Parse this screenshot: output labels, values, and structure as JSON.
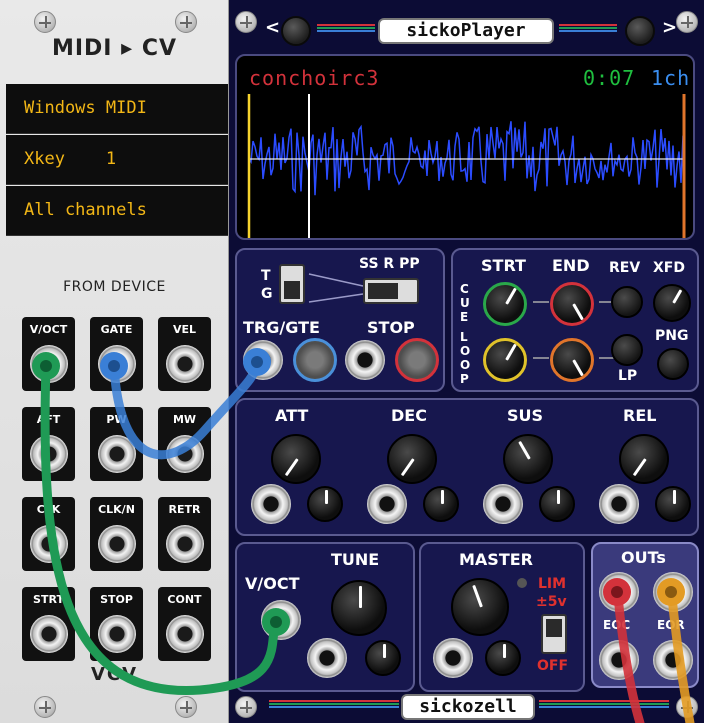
{
  "midi_module": {
    "title": "MIDI ▸ CV",
    "driver": "Windows MIDI",
    "device": "Xkey    1",
    "channel": "All channels",
    "section_label": "FROM DEVICE",
    "jacks": [
      "V/OCT",
      "GATE",
      "VEL",
      "AFT",
      "PW",
      "MW",
      "CLK",
      "CLK/N",
      "RETR",
      "STRT",
      "STOP",
      "CONT"
    ],
    "brand": "VCV"
  },
  "player": {
    "name": "sickoPlayer",
    "prev_arrow": "<",
    "next_arrow": ">",
    "display": {
      "sample_name": "conchoirc3",
      "time": "0:07",
      "channels": "1ch"
    },
    "trig": {
      "mode_top": "T",
      "mode_bottom": "G",
      "switch_label": "SS R PP",
      "trg_gte_label": "TRG/GTE",
      "stop_label": "STOP"
    },
    "cue": {
      "cue_label": "CUE",
      "loop_label": "LOOP",
      "start_label": "STRT",
      "end_label": "END",
      "rev_label": "REV",
      "xfd_label": "XFD",
      "png_label": "PNG",
      "lp_label": "LP"
    },
    "envelope": {
      "labels": [
        "ATT",
        "DEC",
        "SUS",
        "REL"
      ]
    },
    "tune": {
      "label": "TUNE",
      "voct_label": "V/OCT"
    },
    "master": {
      "label": "MASTER",
      "lim_label": "LIM",
      "range_label": "±5v",
      "off_label": "OFF"
    },
    "outs": {
      "label": "OUTs",
      "left": "EOC",
      "right": "EOR"
    },
    "brand": "sickozell"
  },
  "colors": {
    "midi_panel": "#e3e3e3",
    "player_panel": "#17174e",
    "waveform": "#2b4cff",
    "amber_text": "#f3b716",
    "cable_green": "#1f9a55",
    "cable_blue": "#3a7fd6",
    "cable_red": "#d3323b",
    "cable_orange": "#e39b24",
    "lim_red": "#e0312e"
  }
}
